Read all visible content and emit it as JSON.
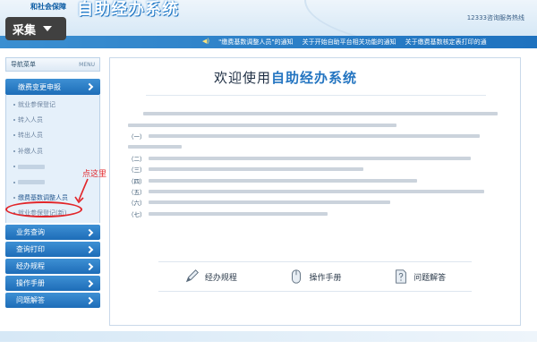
{
  "header": {
    "logo_small": "和社会保障",
    "logo_big": "自助经办系统",
    "hotline": "12333咨询服务热线"
  },
  "overlay": {
    "caiji_label": "采集"
  },
  "notices": {
    "items": [
      "\"缴费基数调整人员\"的通知",
      "关于开始自助平台相关功能的通知",
      "关于缴费基数核定表打印的通"
    ]
  },
  "sidebar": {
    "nav_title": "导航菜单",
    "nav_title_en": "MENU",
    "active_group": "缴费变更申报",
    "sub_items": [
      "就业参保登记",
      "转入人员",
      "转出人员",
      "补缴人员",
      "",
      "",
      "缴费基数调整人员",
      "就业参保登记(新)"
    ],
    "groups": [
      "业务查询",
      "查询打印",
      "经办规程",
      "操作手册",
      "问题解答"
    ]
  },
  "annotation": {
    "label": "点这里"
  },
  "main": {
    "welcome_prefix": "欢迎使用",
    "welcome_brand": "自助经办系统",
    "paragraph_leads": [
      "",
      "（一）",
      "（二）",
      "（三）",
      "（四）",
      "（五）",
      "（六）",
      "（七）"
    ],
    "paragraph_bodies": [
      "",
      "",
      "",
      "",
      "",
      "",
      "",
      ""
    ],
    "actions": [
      "经办规程",
      "操作手册",
      "问题解答"
    ]
  }
}
